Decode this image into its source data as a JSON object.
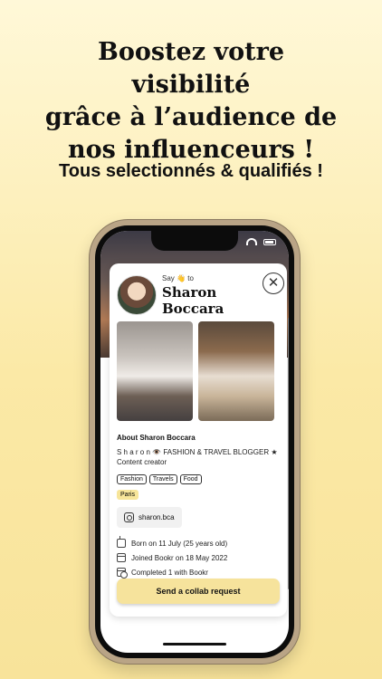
{
  "headline": {
    "line1": "Boostez votre visibilité",
    "line2": "grâce à l’audience de",
    "line3": "nos influenceurs !"
  },
  "subheadline": "Tous selectionnés & qualifiés !",
  "profile": {
    "say_prefix": "Say",
    "say_emoji": "👋",
    "say_suffix": "to",
    "name": "Sharon Boccara",
    "about_title": "About Sharon Boccara",
    "bio": "S h a r o n 👁️ FASHION & TRAVEL BLOGGER ★ Content creator",
    "tags": [
      "Fashion",
      "Travels",
      "Food"
    ],
    "city": "Paris",
    "instagram": "sharon.bca",
    "facts": {
      "born": "Born on 11 July (25 years old)",
      "joined": "Joined Bookr on 18 May 2022",
      "completed": "Completed 1 with Bookr"
    },
    "cta": "Send a collab request"
  },
  "icons": {
    "close": "close-icon",
    "instagram": "instagram-icon",
    "birthday": "cake-icon",
    "calendar": "calendar-icon",
    "completed": "calendar-check-icon"
  },
  "colors": {
    "accent_yellow": "#f6e39c",
    "background_top": "#fff8d8",
    "background_bottom": "#f8e39a"
  }
}
